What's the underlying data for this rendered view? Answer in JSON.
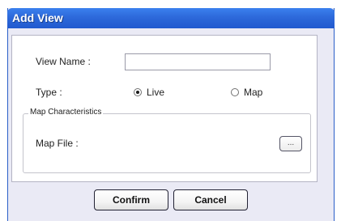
{
  "window": {
    "title": "Add View"
  },
  "form": {
    "view_name_label": "View Name :",
    "view_name_value": "",
    "type_label": "Type :",
    "type_options": [
      {
        "label": "Live",
        "checked": true
      },
      {
        "label": "Map",
        "checked": false
      }
    ],
    "map_group_legend": "Map Characteristics",
    "map_file_label": "Map File :",
    "browse_button_label": "..."
  },
  "buttons": {
    "confirm_label": "Confirm",
    "cancel_label": "Cancel"
  }
}
